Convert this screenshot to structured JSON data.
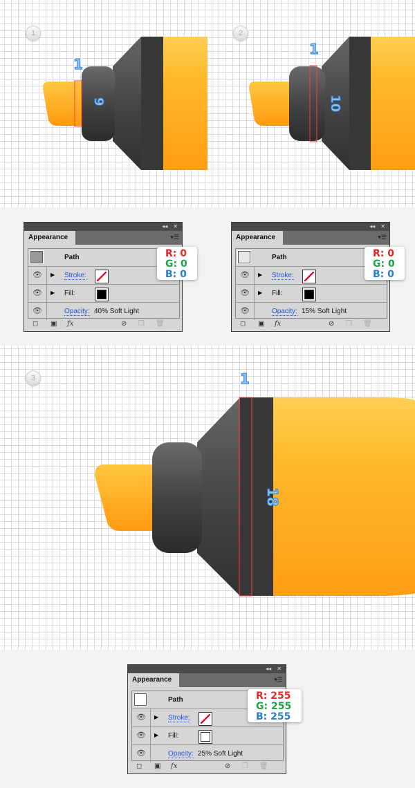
{
  "steps": [
    {
      "badge": "1",
      "width_label": "1",
      "height_label": "9"
    },
    {
      "badge": "2",
      "width_label": "1",
      "height_label": "10"
    },
    {
      "badge": "3",
      "width_label": "1",
      "height_label": "18"
    }
  ],
  "panels": [
    {
      "tab": "Appearance",
      "path": "Path",
      "stroke": "Stroke:",
      "fill": "Fill:",
      "opacity_label": "Opacity:",
      "opacity_value": "40% Soft Light",
      "fill_color": "#000000",
      "thumb_color": "#999999",
      "r": "R: 0",
      "g": "G: 0",
      "b": "B: 0",
      "fx": "fx"
    },
    {
      "tab": "Appearance",
      "path": "Path",
      "stroke": "Stroke:",
      "fill": "Fill:",
      "opacity_label": "Opacity:",
      "opacity_value": "15% Soft Light",
      "fill_color": "#000000",
      "thumb_color": "#e8e8e8",
      "r": "R: 0",
      "g": "G: 0",
      "b": "B: 0",
      "fx": "fx"
    },
    {
      "tab": "Appearance",
      "path": "Path",
      "stroke": "Stroke:",
      "fill": "Fill:",
      "opacity_label": "Opacity:",
      "opacity_value": "25% Soft Light",
      "fill_color": "#ffffff",
      "thumb_color": "#ffffff",
      "r": "R: 255",
      "g": "G: 255",
      "b": "B: 255",
      "fx": "fx"
    }
  ],
  "colors": {
    "marker_body": "#ffb526",
    "marker_cap": "#3f3f3f",
    "selection": "#ff3b3b"
  }
}
